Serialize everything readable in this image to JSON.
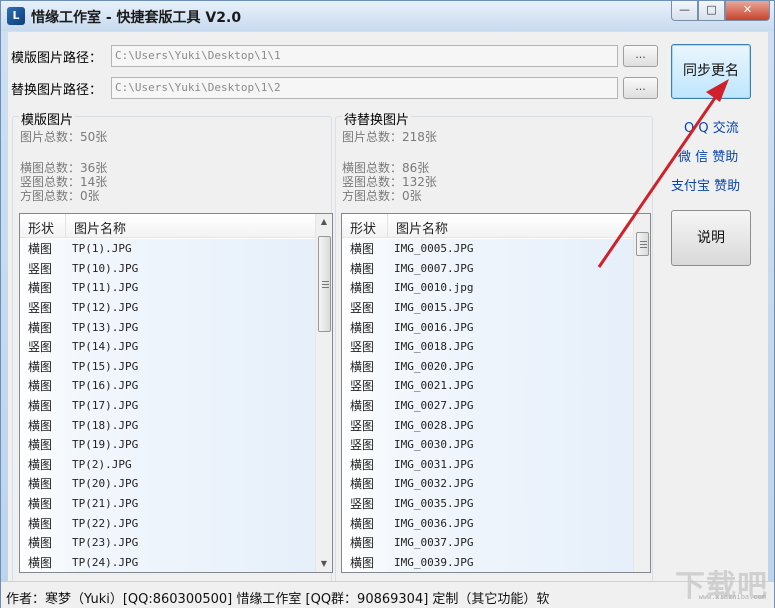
{
  "window": {
    "title": "惜缘工作室 - 快捷套版工具 V2.0",
    "controls": {
      "minimize": "—",
      "maximize": "□",
      "close": "✕"
    }
  },
  "paths": {
    "template_label": "模版图片路径：",
    "template_value": "C:\\Users\\Yuki\\Desktop\\1\\1",
    "replace_label": "替换图片路径：",
    "replace_value": "C:\\Users\\Yuki\\Desktop\\1\\2",
    "browse_label": "..."
  },
  "buttons": {
    "sync_rename": "同步更名",
    "help": "说明"
  },
  "links": {
    "qq": "Q Q 交流",
    "wechat": "微 信 赞助",
    "alipay": "支付宝 赞助"
  },
  "left_panel": {
    "title": "模版图片",
    "total": "图片总数：50张",
    "landscape": "横图总数：36张",
    "portrait": "竖图总数：14张",
    "square": "方图总数：0张",
    "headers": [
      "形状",
      "图片名称"
    ],
    "rows": [
      {
        "shape": "横图",
        "name": "TP(1).JPG"
      },
      {
        "shape": "竖图",
        "name": "TP(10).JPG"
      },
      {
        "shape": "横图",
        "name": "TP(11).JPG"
      },
      {
        "shape": "竖图",
        "name": "TP(12).JPG"
      },
      {
        "shape": "横图",
        "name": "TP(13).JPG"
      },
      {
        "shape": "竖图",
        "name": "TP(14).JPG"
      },
      {
        "shape": "横图",
        "name": "TP(15).JPG"
      },
      {
        "shape": "横图",
        "name": "TP(16).JPG"
      },
      {
        "shape": "横图",
        "name": "TP(17).JPG"
      },
      {
        "shape": "横图",
        "name": "TP(18).JPG"
      },
      {
        "shape": "横图",
        "name": "TP(19).JPG"
      },
      {
        "shape": "横图",
        "name": "TP(2).JPG"
      },
      {
        "shape": "横图",
        "name": "TP(20).JPG"
      },
      {
        "shape": "横图",
        "name": "TP(21).JPG"
      },
      {
        "shape": "横图",
        "name": "TP(22).JPG"
      },
      {
        "shape": "横图",
        "name": "TP(23).JPG"
      },
      {
        "shape": "横图",
        "name": "TP(24).JPG"
      }
    ]
  },
  "right_panel": {
    "title": "待替换图片",
    "total": "图片总数：218张",
    "landscape": "横图总数：86张",
    "portrait": "竖图总数：132张",
    "square": "方图总数：0张",
    "headers": [
      "形状",
      "图片名称"
    ],
    "rows": [
      {
        "shape": "横图",
        "name": "IMG_0005.JPG"
      },
      {
        "shape": "横图",
        "name": "IMG_0007.JPG"
      },
      {
        "shape": "横图",
        "name": "IMG_0010.jpg"
      },
      {
        "shape": "竖图",
        "name": "IMG_0015.JPG"
      },
      {
        "shape": "横图",
        "name": "IMG_0016.JPG"
      },
      {
        "shape": "竖图",
        "name": "IMG_0018.JPG"
      },
      {
        "shape": "横图",
        "name": "IMG_0020.JPG"
      },
      {
        "shape": "竖图",
        "name": "IMG_0021.JPG"
      },
      {
        "shape": "横图",
        "name": "IMG_0027.JPG"
      },
      {
        "shape": "竖图",
        "name": "IMG_0028.JPG"
      },
      {
        "shape": "竖图",
        "name": "IMG_0030.JPG"
      },
      {
        "shape": "横图",
        "name": "IMG_0031.JPG"
      },
      {
        "shape": "横图",
        "name": "IMG_0032.JPG"
      },
      {
        "shape": "竖图",
        "name": "IMG_0035.JPG"
      },
      {
        "shape": "横图",
        "name": "IMG_0036.JPG"
      },
      {
        "shape": "横图",
        "name": "IMG_0037.JPG"
      },
      {
        "shape": "横图",
        "name": "IMG_0039.JPG"
      }
    ]
  },
  "status": {
    "text": "作者：寒梦（Yuki）[QQ:860300500]  惜缘工作室 [QQ群：90869304]    定制（其它功能）软"
  },
  "watermark": {
    "logo": "下载吧",
    "url": "www.xiazaiba.com"
  },
  "colors": {
    "annotation_arrow": "#d0202a",
    "link": "#0645ad"
  },
  "icons": {
    "app": "app-logo-icon",
    "arrow": "red-pointer-arrow"
  }
}
